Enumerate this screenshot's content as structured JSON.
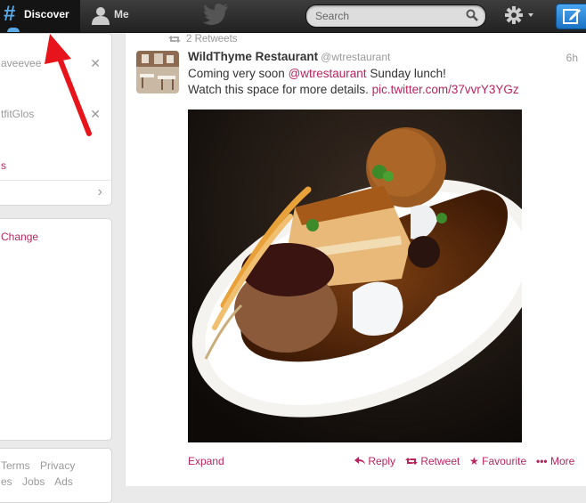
{
  "topbar": {
    "discover_icon": "#",
    "discover_label": "Discover",
    "me_label": "Me",
    "search_placeholder": "Search"
  },
  "sidebar": {
    "suggestions": [
      {
        "name": "aveevee"
      },
      {
        "name": "tfitGlos"
      }
    ],
    "link_label": "s",
    "change_label": "Change",
    "footer_row1": [
      "Terms",
      "Privacy"
    ],
    "footer_row2": [
      "es",
      "Jobs",
      "Ads"
    ]
  },
  "tweet": {
    "retweet_context": "2 Retweets",
    "fullname": "WildThyme Restaurant",
    "handle": "@wtrestaurant",
    "time": "6h",
    "text_line1_before": "Coming very soon ",
    "text_mention": "@wtrestaurant",
    "text_line1_after": " Sunday lunch!",
    "text_line2_before": "Watch this space for more details. ",
    "text_link": "pic.twitter.com/37vvrY3YGz",
    "expand_label": "Expand",
    "reply_label": "Reply",
    "retweet_label": "Retweet",
    "favourite_label": "Favourite",
    "more_label": "More"
  },
  "colors": {
    "link": "#b8245e",
    "topbar": "#2b2b2b",
    "discover_blue": "#5aaae8",
    "annotation_arrow": "#e8141c"
  },
  "icons": [
    "hash-icon",
    "person-icon",
    "twitter-bird-icon",
    "search-icon",
    "gear-icon",
    "compose-icon",
    "close-icon",
    "chevron-right-icon",
    "retweet-icon",
    "reply-icon",
    "star-icon",
    "more-dots-icon"
  ]
}
